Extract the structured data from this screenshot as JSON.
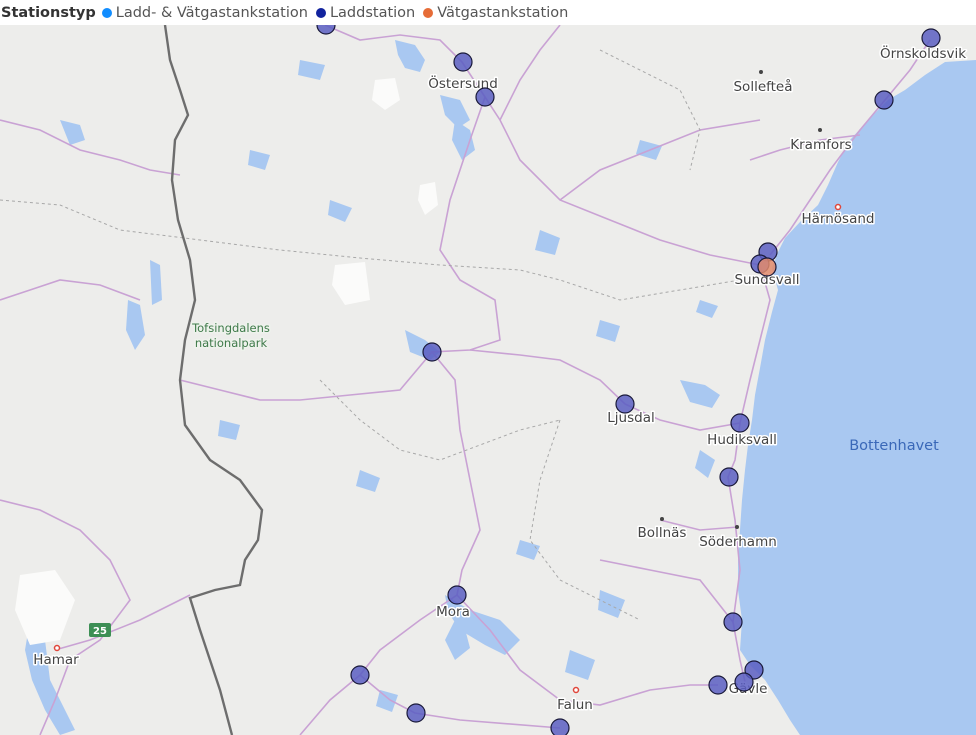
{
  "legend": {
    "title": "Stationstyp",
    "items": [
      {
        "label": "Ladd- & Vätgastankstation",
        "color": "#118dff"
      },
      {
        "label": "Laddstation",
        "color": "#12239e"
      },
      {
        "label": "Vätgastankstation",
        "color": "#e66c37"
      }
    ]
  },
  "map": {
    "sea_label": "Bottenhavet",
    "park_label_line1": "Tofsingdalens",
    "park_label_line2": "nationalpark",
    "road_shield": "25",
    "places": {
      "ornskoldsvik": "Örnskoldsvik",
      "sollefte": "Sollefteå",
      "kramfors": "Kramfors",
      "harnosand": "Härnösand",
      "sundsvall": "Sundsvall",
      "ostersund": "Östersund",
      "ljusdal": "Ljusdal",
      "hudiksvall": "Hudiksvall",
      "bollnas": "Bollnäs",
      "soderhamn": "Söderhamn",
      "mora": "Mora",
      "falun": "Falun",
      "gavle": "Gävle",
      "hamar": "Hamar"
    },
    "colors": {
      "land": "#ededeb",
      "water": "#a9c8f1",
      "road": "#c9a2d4",
      "border": "#6d6d6d",
      "charging_marker": "#5a5ec2",
      "hydrogen_marker": "#e08a6b"
    }
  }
}
